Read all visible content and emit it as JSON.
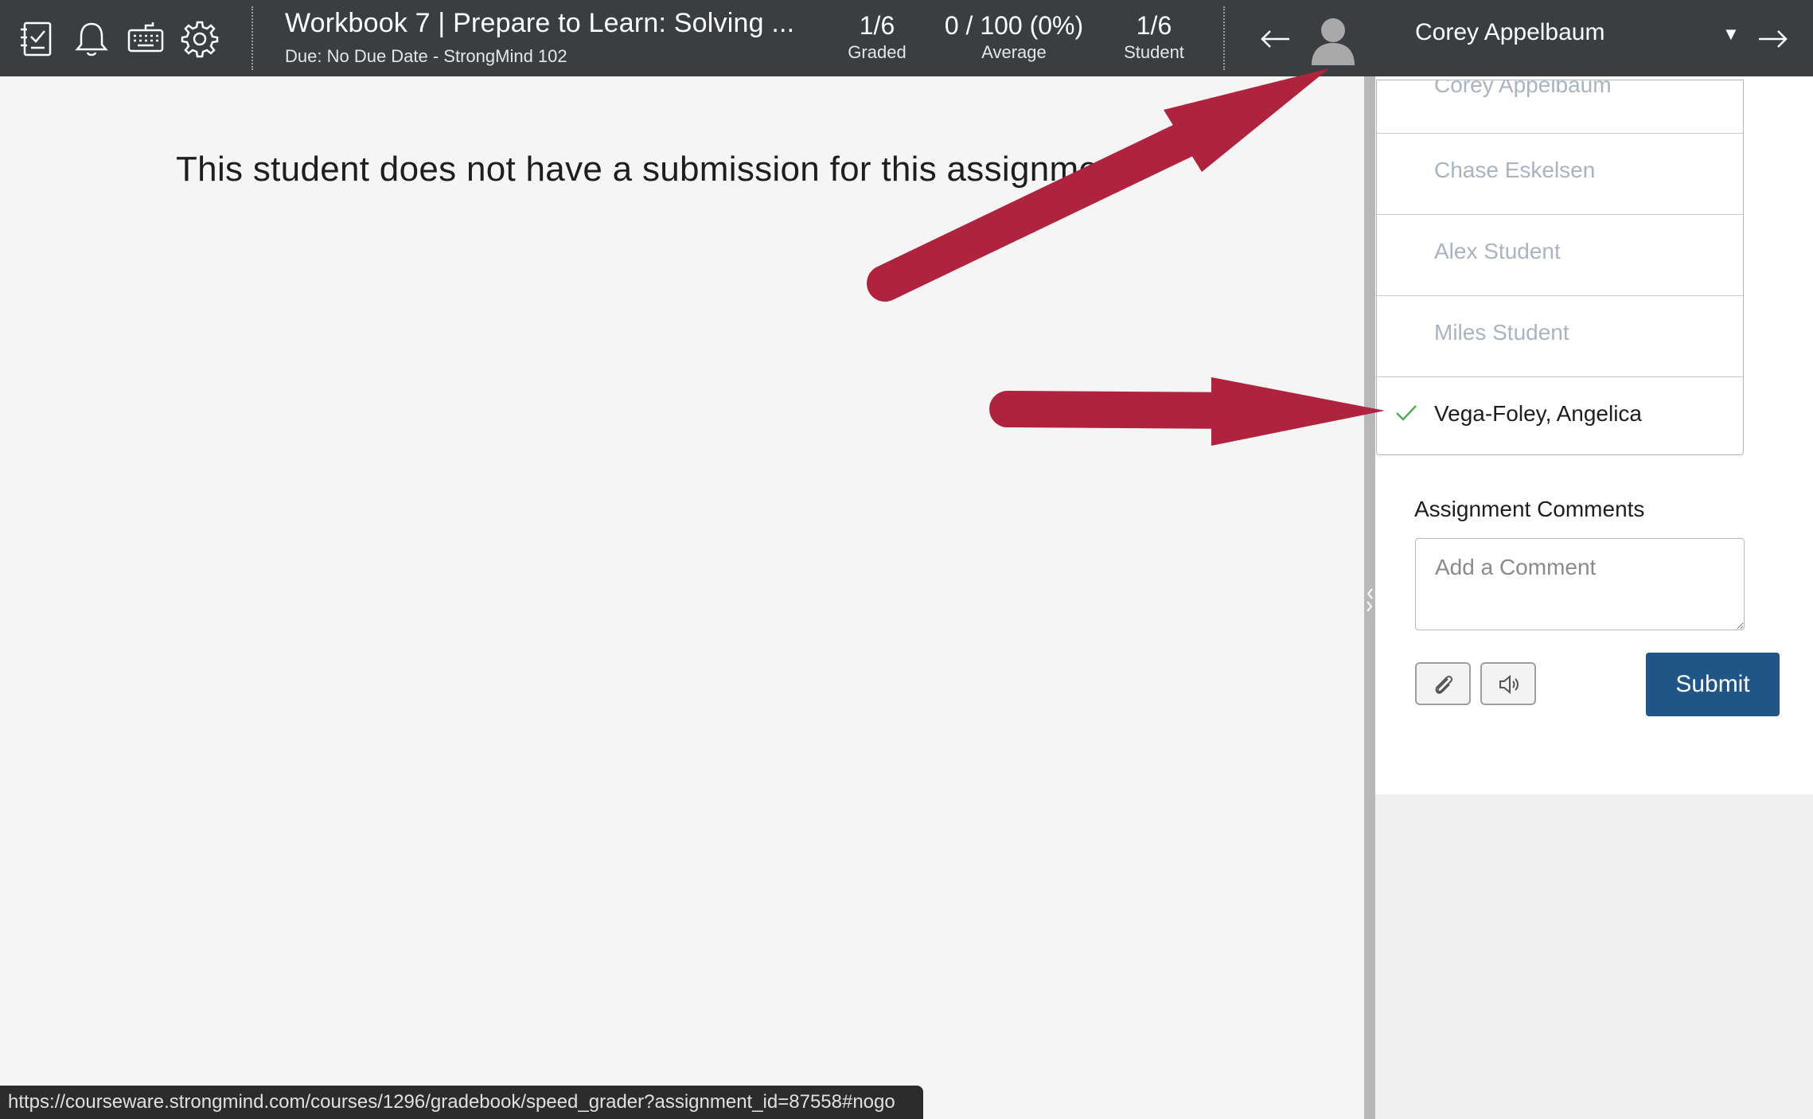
{
  "topbar": {
    "icons": [
      "gradebook-icon",
      "bell-icon",
      "keyboard-icon",
      "gear-icon"
    ],
    "assignment_title": "Workbook 7 | Prepare to Learn: Solving ...",
    "assignment_due": "Due: No Due Date - StrongMind 102",
    "stats": [
      {
        "value": "1/6",
        "label": "Graded"
      },
      {
        "value": "0 / 100 (0%)",
        "label": "Average"
      },
      {
        "value": "1/6",
        "label": "Student"
      }
    ],
    "current_student": "Corey Appelbaum"
  },
  "main": {
    "message": "This student does not have a submission for this assignment"
  },
  "student_dropdown": {
    "items": [
      {
        "name": "Corey Appelbaum",
        "selected": false
      },
      {
        "name": "Chase Eskelsen",
        "selected": false
      },
      {
        "name": "Alex Student",
        "selected": false
      },
      {
        "name": "Miles Student",
        "selected": false
      },
      {
        "name": "Vega-Foley, Angelica",
        "selected": true
      }
    ]
  },
  "comments": {
    "label": "Assignment Comments",
    "placeholder": "Add a Comment",
    "submit_label": "Submit"
  },
  "statusbar": {
    "url": "https://courseware.strongmind.com/courses/1296/gradebook/speed_grader?assignment_id=87558#nogo"
  },
  "colors": {
    "topbar_bg": "#3a3e41",
    "submit_bg": "#1f5587",
    "annotation_arrow": "#b0233e",
    "check": "#4caf50"
  }
}
